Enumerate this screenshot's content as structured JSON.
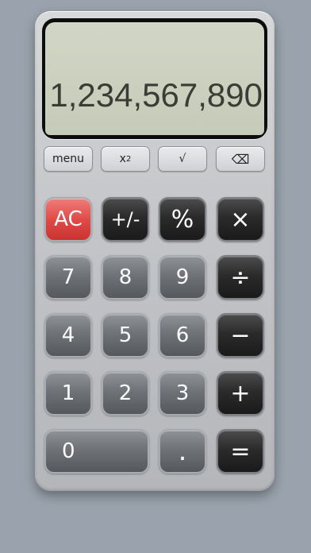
{
  "display": {
    "value": "1,234,567,890"
  },
  "function_row": {
    "menu": "menu",
    "square_base": "x",
    "square_exp": "2",
    "sqrt": "√",
    "backspace_icon": "⌫"
  },
  "keys": {
    "ac": "AC",
    "plus_minus": "+/-",
    "percent": "%",
    "multiply": "×",
    "divide": "÷",
    "subtract": "−",
    "add": "+",
    "equals": "=",
    "decimal": ".",
    "digits": [
      "0",
      "1",
      "2",
      "3",
      "4",
      "5",
      "6",
      "7",
      "8",
      "9"
    ]
  }
}
